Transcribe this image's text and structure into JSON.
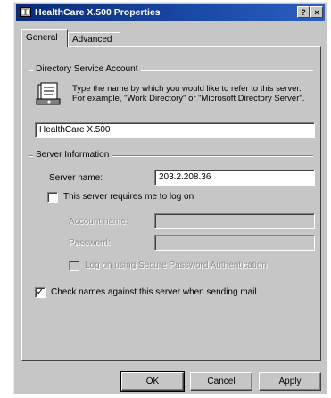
{
  "window": {
    "title": "HealthCare X.500 Properties",
    "help_button": "?",
    "close_button": "×"
  },
  "tabs": [
    {
      "label": "General",
      "active": true
    },
    {
      "label": "Advanced",
      "active": false
    }
  ],
  "directory_group": {
    "label": "Directory Service Account",
    "description": "Type the name by which you would like to refer to this server. For example, \"Work Directory\" or \"Microsoft Directory Server\".",
    "name_value": "HealthCare X.500"
  },
  "server_group": {
    "label": "Server Information",
    "server_name_label": "Server name:",
    "server_name_value": "203.2.208.36",
    "logon_checkbox": {
      "label": "This server requires me to log on",
      "checked": false
    },
    "account_name_label": "Account name:",
    "account_name_value": "",
    "password_label": "Password:",
    "password_value": "",
    "spa_checkbox": {
      "label": "Log on using Secure Password Authentication",
      "checked": false
    }
  },
  "check_names_checkbox": {
    "label": "Check names against this server when sending mail",
    "checked": true,
    "mark": "✓"
  },
  "buttons": {
    "ok": "OK",
    "cancel": "Cancel",
    "apply": "Apply"
  },
  "colors": {
    "titlebar": "#0a2a78",
    "dialog_bg": "#c6c6c6"
  }
}
